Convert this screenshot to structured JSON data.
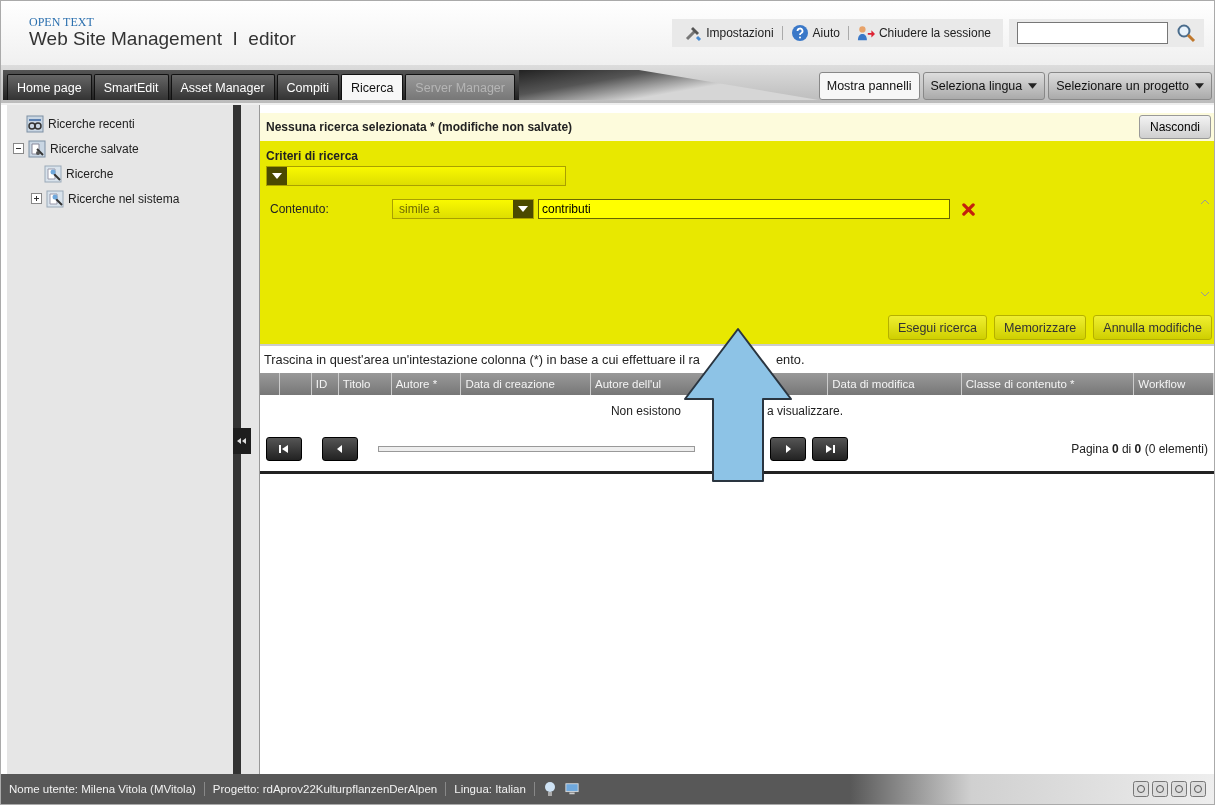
{
  "header": {
    "brand": "OPEN TEXT",
    "title": "Web Site Management  I  editor"
  },
  "toolbar": [
    {
      "label": "Impostazioni",
      "kind": "settings"
    },
    {
      "label": "Aiuto",
      "kind": "help"
    },
    {
      "label": "Chiudere la sessione",
      "kind": "logout"
    }
  ],
  "tabs": [
    {
      "label": "Home page",
      "selected": false,
      "disabled": false
    },
    {
      "label": "SmartEdit",
      "selected": false,
      "disabled": false
    },
    {
      "label": "Asset Manager",
      "selected": false,
      "disabled": false
    },
    {
      "label": "Compiti",
      "selected": false,
      "disabled": false
    },
    {
      "label": "Ricerca",
      "selected": true,
      "disabled": false
    },
    {
      "label": "Server Manager",
      "selected": false,
      "disabled": true
    }
  ],
  "tab_actions": [
    {
      "label": "Mostra pannelli",
      "kind": "button"
    },
    {
      "label": "Seleziona lingua",
      "kind": "dropdown"
    },
    {
      "label": "Selezionare un progetto",
      "kind": "dropdown"
    }
  ],
  "sidebar": {
    "items": [
      {
        "label": "Ricerche recenti",
        "kind": "recent"
      },
      {
        "label": "Ricerche salvate",
        "kind": "saved",
        "expanded": true,
        "children": [
          {
            "label": "Ricerche",
            "kind": "search"
          },
          {
            "label": "Ricerche nel sistema",
            "kind": "search",
            "expanded": false
          }
        ]
      }
    ]
  },
  "search_panel": {
    "title": "Nessuna ricerca selezionata * (modifiche non salvate)",
    "hide_button": "Nascondi",
    "criteria_label": "Criteri di ricerca",
    "condition": {
      "label": "Contenuto:",
      "operator": "simile a",
      "operator_disabled": true,
      "value": "contributi"
    },
    "buttons": [
      "Esegui ricerca",
      "Memorizzare",
      "Annulla modifiche"
    ]
  },
  "results": {
    "hint_parts": [
      "Trascina in quest'area un'intestazione colonna (*) in base a cui effettuare il ra",
      "ento."
    ],
    "columns": [
      "",
      "",
      "ID",
      "Titolo",
      "Autore *",
      "Data di creazione",
      "Autore dell'ul",
      "Data di modifica",
      "Classe di contenuto *",
      "Workflow"
    ],
    "empty_parts": [
      "Non esistono",
      "a visualizzare."
    ],
    "pager": "Pagina **0** di **0** (0 elementi)"
  },
  "status_bar": [
    "Nome utente: Milena Vitola (MVitola)",
    "Progetto: rdAprov22KulturpflanzenDerAlpen",
    "Lingua: Italian"
  ]
}
